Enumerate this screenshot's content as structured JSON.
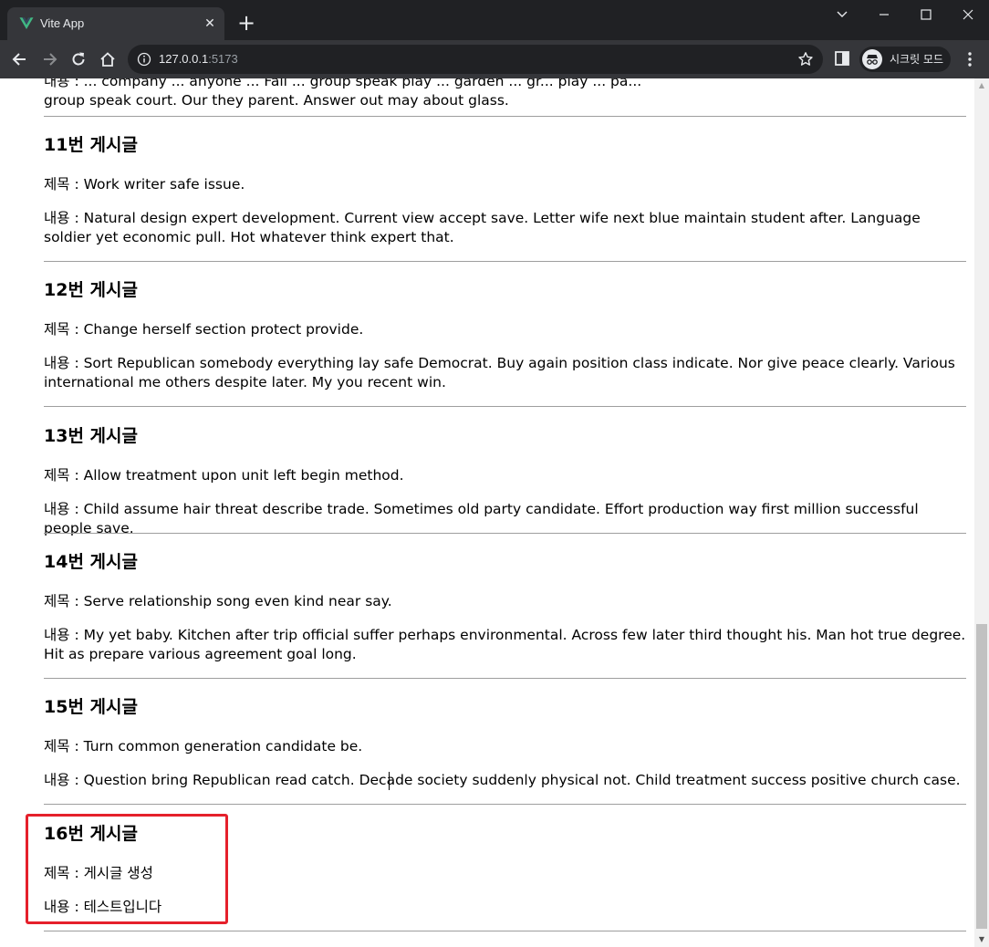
{
  "browser": {
    "tab_title": "Vite App",
    "tab_close_glyph": "✕",
    "new_tab_glyph": "+",
    "url_host": "127.0.0.1",
    "url_port": ":5173",
    "incognito_label": "시크릿 모드",
    "window_controls": {
      "chevron": "⌄",
      "minimize": "—",
      "maximize": "☐",
      "close": "✕"
    },
    "icons": {
      "favicon": "vue-logo-icon",
      "back": "back-arrow-icon",
      "forward": "forward-arrow-icon",
      "reload": "reload-icon",
      "home": "home-icon",
      "site_info": "info-icon",
      "bookmark": "star-icon",
      "side_panel": "side-panel-icon",
      "incognito": "incognito-icon",
      "menu": "kebab-menu-icon"
    }
  },
  "page": {
    "partial_previous_post": {
      "content_line1": "내용 : ... company ... anyone ... Fall ... group speak play ... garden ... gr... play ... pa...",
      "content_line2": "group speak court. Our they parent. Answer out may about glass."
    },
    "posts": [
      {
        "heading": "11번 게시글",
        "title": "제목 : Work writer safe issue.",
        "content": "내용 : Natural design expert development. Current view accept save. Letter wife next blue maintain student after. Language soldier yet economic pull. Hot whatever think expert that."
      },
      {
        "heading": "12번 게시글",
        "title": "제목 : Change herself section protect provide.",
        "content": "내용 : Sort Republican somebody everything lay safe Democrat. Buy again position class indicate. Nor give peace clearly. Various international me others despite later. My you recent win."
      },
      {
        "heading": "13번 게시글",
        "title": "제목 : Allow treatment upon unit left begin method.",
        "content": "내용 : Child assume hair threat describe trade. Sometimes old party candidate. Effort production way first million successful people save."
      },
      {
        "heading": "14번 게시글",
        "title": "제목 : Serve relationship song even kind near say.",
        "content": "내용 : My yet baby. Kitchen after trip official suffer perhaps environmental. Across few later third thought his. Man hot true degree. Hit as prepare various agreement goal long."
      },
      {
        "heading": "15번 게시글",
        "title": "제목 : Turn common generation candidate be.",
        "content": "내용 : Question bring Republican read catch. Decade society suddenly physical not. Child treatment success positive church case."
      },
      {
        "heading": "16번 게시글",
        "title": "제목 : 게시글 생성",
        "content": "내용 : 테스트입니다"
      }
    ],
    "highlight_color": "#e5202b"
  }
}
